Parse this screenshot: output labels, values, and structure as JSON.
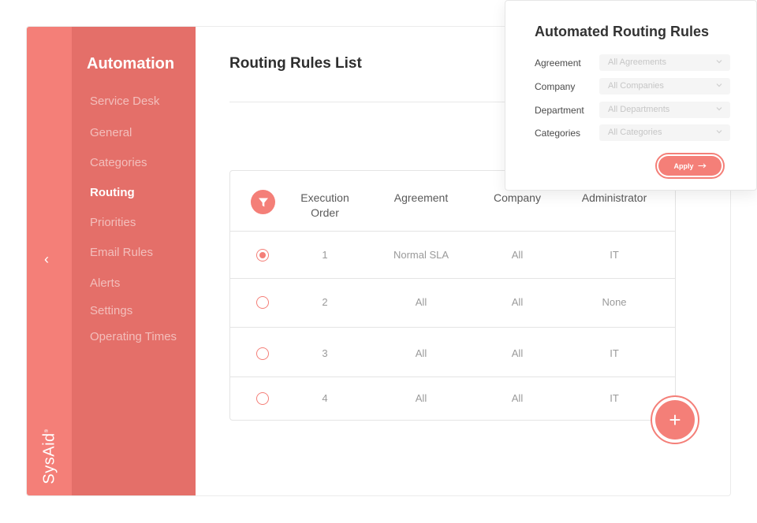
{
  "rail": {
    "back_icon": "chevron-left-icon",
    "logo_text": "SysAid",
    "logo_mark": "®"
  },
  "menu": {
    "title": "Automation",
    "items": [
      {
        "label": "Service Desk",
        "active": false
      },
      {
        "label": "General",
        "active": false
      },
      {
        "label": "Categories",
        "active": false
      },
      {
        "label": "Routing",
        "active": true
      },
      {
        "label": "Priorities",
        "active": false
      },
      {
        "label": "Email Rules",
        "active": false
      },
      {
        "label": "Alerts",
        "active": false
      },
      {
        "label": "Settings",
        "active": false
      },
      {
        "label": "Operating Times",
        "active": false
      }
    ]
  },
  "main": {
    "title": "Routing Rules List",
    "table": {
      "filter_icon": "filter-icon",
      "columns": [
        "Execution Order",
        "Agreement",
        "Company",
        "Administrator"
      ],
      "rows": [
        {
          "selected": true,
          "order": "1",
          "agreement": "Normal SLA",
          "company": "All",
          "administrator": "IT"
        },
        {
          "selected": false,
          "order": "2",
          "agreement": "All",
          "company": "All",
          "administrator": "None"
        },
        {
          "selected": false,
          "order": "3",
          "agreement": "All",
          "company": "All",
          "administrator": "IT"
        },
        {
          "selected": false,
          "order": "4",
          "agreement": "All",
          "company": "All",
          "administrator": "IT"
        }
      ]
    },
    "add_button": {
      "label": "+",
      "icon": "plus-icon"
    }
  },
  "filter_panel": {
    "title": "Automated Routing Rules",
    "fields": [
      {
        "label": "Agreement",
        "value": "All Agreements"
      },
      {
        "label": "Company",
        "value": "All Companies"
      },
      {
        "label": "Department",
        "value": "All Departments"
      },
      {
        "label": "Categories",
        "value": "All Categories"
      }
    ],
    "apply_label": "Apply",
    "apply_icon": "arrow-right-icon"
  },
  "colors": {
    "accent": "#f47f78",
    "menu_bg": "#e46f69",
    "rail_bg": "#f47f78"
  }
}
